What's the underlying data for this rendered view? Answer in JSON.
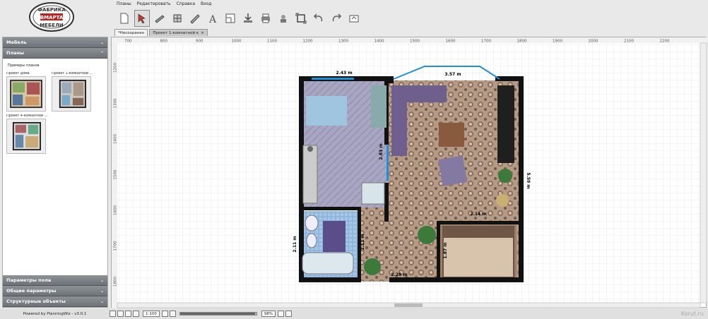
{
  "logo": {
    "text_top": "ФАБРИКА",
    "text_mid": "BMAPTA",
    "text_bottom": "МЕБЕЛИ"
  },
  "menu": [
    "Планы",
    "Редактировать",
    "Справка",
    "Вход"
  ],
  "toolbar": [
    {
      "icon": "new-document-icon"
    },
    {
      "icon": "select-arrow-icon",
      "active": true
    },
    {
      "icon": "wall-icon"
    },
    {
      "icon": "room-icon"
    },
    {
      "icon": "dimension-icon"
    },
    {
      "icon": "text-icon"
    },
    {
      "icon": "plan-icon"
    },
    {
      "icon": "import-icon"
    },
    {
      "icon": "print-icon"
    },
    {
      "icon": "add-furniture-icon"
    },
    {
      "icon": "fit-icon"
    },
    {
      "icon": "undo-icon"
    },
    {
      "icon": "redo-icon"
    },
    {
      "icon": "export-icon"
    }
  ],
  "tabs": [
    {
      "label": "*Несохранен",
      "selected": false
    },
    {
      "label": "Проект 1-комнатной к",
      "selected": true
    }
  ],
  "sidebar": {
    "furniture": "Мебель",
    "plans": "Планы",
    "plans_heading": "Примеры планов",
    "thumbs": [
      {
        "caption": "Проект дома"
      },
      {
        "caption": "Проект 1-комнатной ..."
      },
      {
        "caption": "Проект 4-комнатной ..."
      }
    ],
    "floor_params": "Параметры пола",
    "general_params": "Общие параметры",
    "structural": "Структурные объекты"
  },
  "ruler_x": [
    "700",
    "800",
    "900",
    "1000",
    "1100",
    "1200",
    "1300",
    "1400",
    "1500",
    "1600",
    "1700",
    "1800",
    "1900",
    "2000",
    "2100",
    "2200"
  ],
  "ruler_y": [
    "1200",
    "1300",
    "1400",
    "1500",
    "1600",
    "1700",
    "1800"
  ],
  "dimensions": {
    "kitchen_width": "2.43 m",
    "living_width": "3.57 m",
    "right_height": "5.59 m",
    "kitchen_door": "2.83 m",
    "hall_width": "2.14 m",
    "bath_height": "2.11 m",
    "corridor": "2.11 m",
    "bottom": "2.28 m",
    "bedroom_h": "1.87 m"
  },
  "status": {
    "powered": "Powered by PlanningWiz - v3.0.1",
    "scale": "1:100",
    "zoom": "98%",
    "zoom_fraction": 0.98
  },
  "watermark": "Korut.ru",
  "colors": {
    "accent": "#1e90d8",
    "wall": "#111111",
    "header": "#7a8086"
  }
}
